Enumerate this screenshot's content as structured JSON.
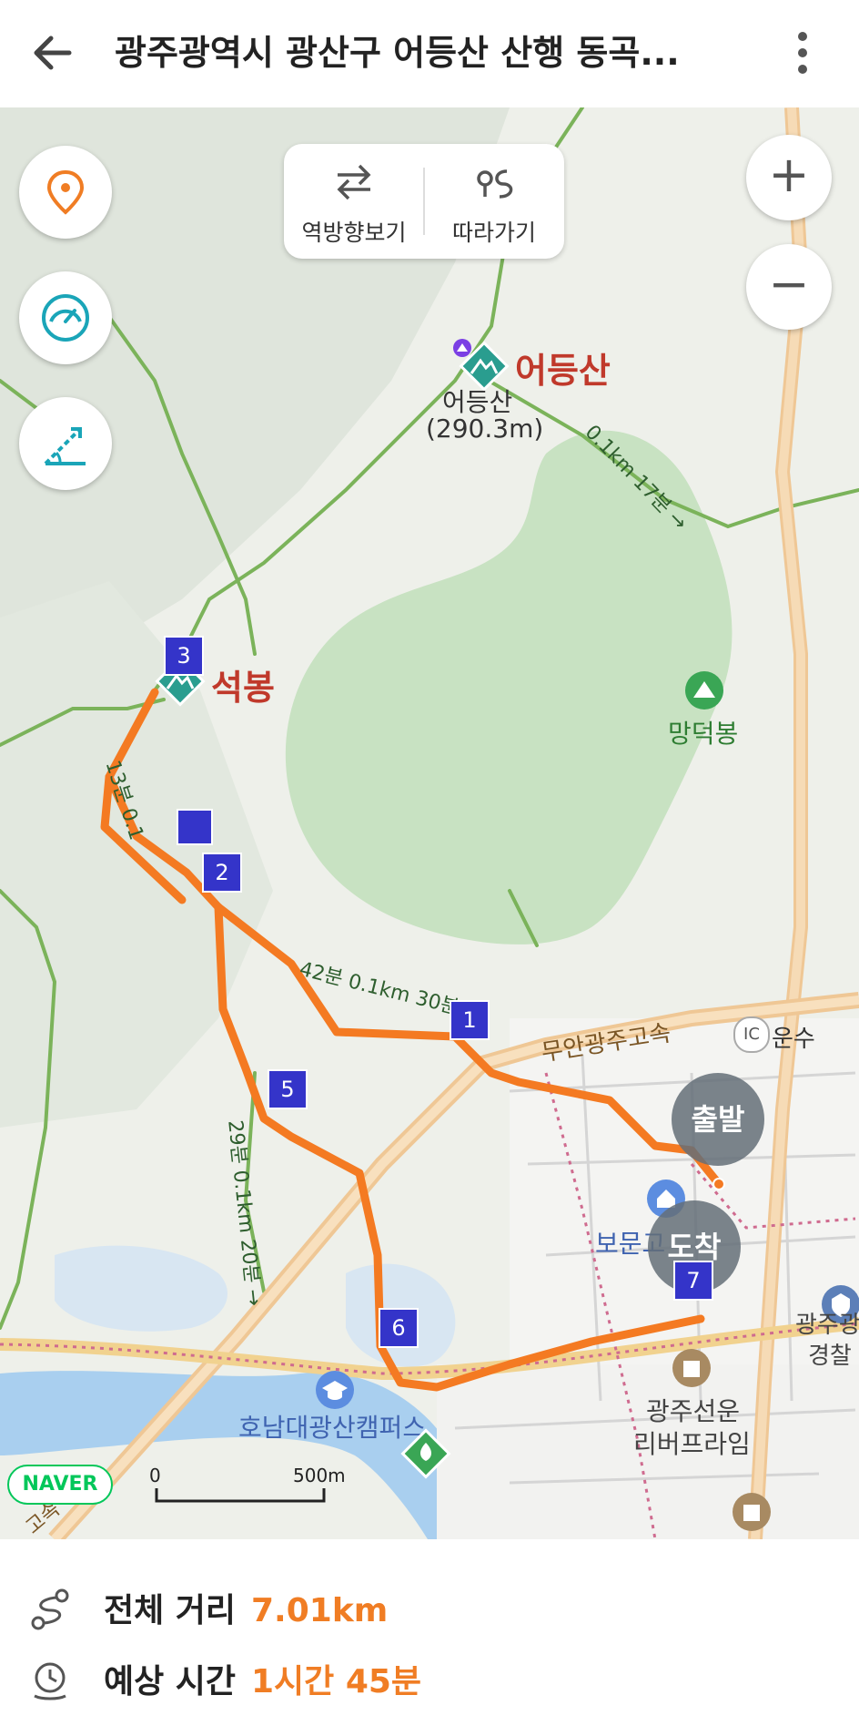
{
  "header": {
    "title": "광주광역시 광산구 어등산 산행  동곡...",
    "back_icon": "back-arrow-icon",
    "more_icon": "more-vertical-icon"
  },
  "toolbar": {
    "reverse_label": "역방향보기",
    "follow_label": "따라가기"
  },
  "map": {
    "peak_main_name": "어등산",
    "peak_main_sub": "어등산",
    "peak_main_elev": "(290.3m)",
    "peak_seokbong": "석봉",
    "peak_mangdeok": "망덕봉",
    "road_highway": "무안광주고속",
    "ic_badge": "IC",
    "ic_name": "운수",
    "school": "보문고",
    "campus": "호남대광산캠퍼스",
    "apartment_line1": "광주선운",
    "apartment_line2": "리버프라임",
    "police_line1": "광주광",
    "police_line2": "경찰",
    "road_bottom": "고속",
    "start_label": "출발",
    "end_label": "도착",
    "trail_label_1": "0.1km 17분 →",
    "trail_label_2": "42분 0.1km 30분",
    "trail_label_3": "29분 0.1km 20분 →",
    "trail_label_4": "13분 0.1",
    "waypoints": [
      "1",
      "2",
      "3",
      "5",
      "6",
      "7"
    ],
    "scale_zero": "0",
    "scale_value": "500m",
    "brand": "NAVER"
  },
  "summary": {
    "distance_label": "전체 거리",
    "distance_value": "7.01km",
    "time_label": "예상 시간",
    "time_value": "1시간 45분"
  },
  "colors": {
    "route": "#f47a22",
    "accent": "#f07d24",
    "trail": "#6ab04c",
    "marker": "#3a3ad6"
  }
}
